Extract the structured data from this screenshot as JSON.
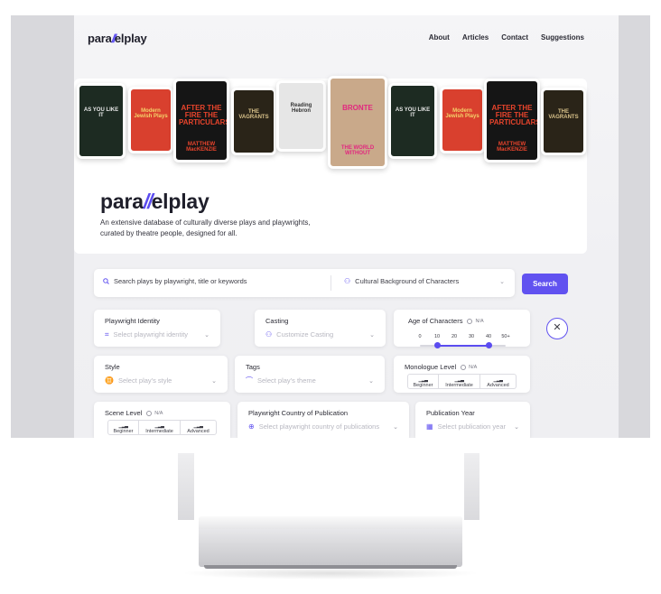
{
  "nav": {
    "logo_prefix": "para",
    "logo_slashes": "//",
    "logo_suffix": "elplay",
    "links": [
      "About",
      "Articles",
      "Contact",
      "Suggestions"
    ]
  },
  "hero": {
    "logo_prefix": "para",
    "logo_slashes": "//",
    "logo_suffix": "elplay",
    "tagline_line1": "An extensive database of culturally diverse plays and playwrights,",
    "tagline_line2": "curated by theatre people, designed for all.",
    "covers": [
      {
        "text": "AS YOU LIKE IT",
        "bg": "#1d2b22",
        "fg": "#e8e8e8"
      },
      {
        "text": "Modern Jewish Plays",
        "bg": "#d9402e",
        "fg": "#f5d36a"
      },
      {
        "text": "AFTER THE FIRE THE PARTICULARS",
        "bg": "#151515",
        "fg": "#e8442c",
        "sub": "MATTHEW MacKENZIE"
      },
      {
        "text": "THE VAGRANTS",
        "bg": "#2a2418",
        "fg": "#d9c28a"
      },
      {
        "text": "Reading Hebron",
        "bg": "#e6e6e6",
        "fg": "#333333"
      },
      {
        "text": "BRONTE",
        "bg": "#c9a98a",
        "fg": "#e2287f",
        "sub": "THE WORLD WITHOUT"
      },
      {
        "text": "AS YOU LIKE IT",
        "bg": "#1d2b22",
        "fg": "#e8e8e8"
      },
      {
        "text": "Modern Jewish Plays",
        "bg": "#d9402e",
        "fg": "#f5d36a"
      },
      {
        "text": "AFTER THE FIRE THE PARTICULARS",
        "bg": "#151515",
        "fg": "#e8442c",
        "sub": "MATTHEW MacKENZIE"
      },
      {
        "text": "THE VAGRANTS",
        "bg": "#2a2418",
        "fg": "#d9c28a"
      }
    ]
  },
  "search": {
    "placeholder": "Search plays by playwright, title or keywords",
    "select_label": "Cultural Background of Characters",
    "button_label": "Search"
  },
  "filters": {
    "playwright_identity": {
      "title": "Playwright Identity",
      "placeholder": "Select playwright identity"
    },
    "casting": {
      "title": "Casting",
      "placeholder": "Customize Casting"
    },
    "age": {
      "title": "Age of Characters",
      "na": "N/A",
      "ticks": [
        "0",
        "10",
        "20",
        "30",
        "40",
        "50+"
      ],
      "range": [
        10,
        40
      ]
    },
    "style": {
      "title": "Style",
      "placeholder": "Select play's style"
    },
    "tags": {
      "title": "Tags",
      "placeholder": "Select play's theme"
    },
    "monologue": {
      "title": "Monologue Level",
      "na": "N/A",
      "options": [
        "Beginner",
        "Intermediate",
        "Advanced"
      ]
    },
    "scene": {
      "title": "Scene Level",
      "na": "N/A",
      "options": [
        "Beginner",
        "Intermediate",
        "Advanced"
      ]
    },
    "country": {
      "title": "Playwright Country of Publication",
      "placeholder": "Select playwright country of publications"
    },
    "year": {
      "title": "Publication Year",
      "placeholder": "Select publication year"
    }
  },
  "icons": {
    "search": "search-icon",
    "user-group": "user-group-icon",
    "close": "close-icon"
  },
  "colors": {
    "accent": "#6152f0"
  }
}
